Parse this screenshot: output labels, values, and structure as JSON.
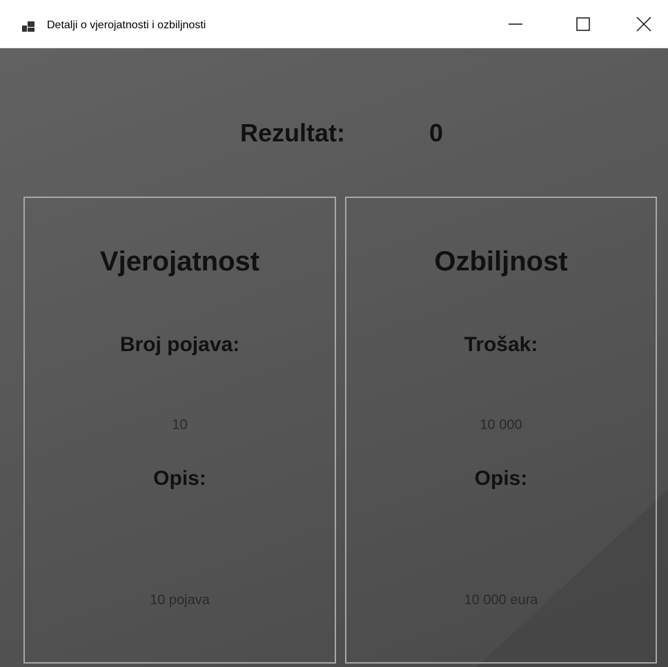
{
  "window": {
    "title": "Detalji o vjerojatnosti i ozbiljnosti",
    "icon": "app-window-icon",
    "controls": {
      "minimize_icon": "minimize-icon",
      "maximize_icon": "maximize-icon",
      "close_icon": "close-icon"
    }
  },
  "result": {
    "label": "Rezultat:",
    "value": "0"
  },
  "probability": {
    "title": "Vjerojatnost",
    "count_label": "Broj pojava:",
    "count_value": "10",
    "description_label": "Opis:",
    "description_value": "10 pojava"
  },
  "severity": {
    "title": "Ozbiljnost",
    "cost_label": "Trošak:",
    "cost_value": "10 000",
    "description_label": "Opis:",
    "description_value": "10 000 eura"
  },
  "colors": {
    "background": "#5a5a5a",
    "text": "#111111",
    "panel_border": "#a8a8a8"
  }
}
